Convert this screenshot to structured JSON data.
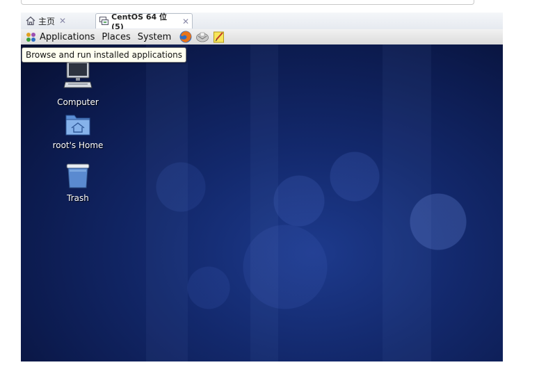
{
  "tabs": [
    {
      "label": "主页",
      "icon": "home-icon",
      "active": false
    },
    {
      "label": "CentOS 64 位 (5)",
      "icon": "vm-icon",
      "active": true
    }
  ],
  "menubar": {
    "applications": "Applications",
    "places": "Places",
    "system": "System",
    "launchers": [
      "firefox-icon",
      "mail-icon",
      "notes-icon"
    ]
  },
  "tooltip": "Browse and run installed applications",
  "desktop": {
    "icons": [
      {
        "label": "Computer",
        "icon": "computer-icon"
      },
      {
        "label": "root's Home",
        "icon": "home-folder-icon"
      },
      {
        "label": "Trash",
        "icon": "trash-icon"
      }
    ]
  },
  "colors": {
    "desktop_bg": "#13296d",
    "menubar_bg": "#dcdcdc"
  }
}
